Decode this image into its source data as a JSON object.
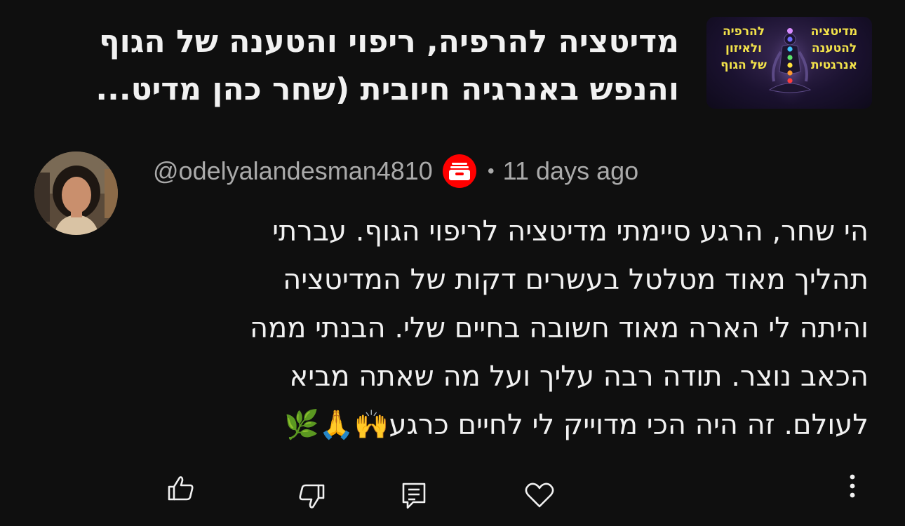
{
  "video": {
    "title_line1": "מדיטציה להרפיה, ריפוי והטענה של הגוף",
    "title_line2": "והנפש באנרגיה חיובית (שחר כהן מדיט...",
    "thumbnail": {
      "text_right": [
        "מדיטציה",
        "להטענה",
        "אנרגטית"
      ],
      "text_left": [
        "להרפיה",
        "ולאיזון",
        "של הגוף"
      ],
      "text_color": "#f3e34a"
    }
  },
  "comment": {
    "author": "@odelyalandesman4810",
    "separator": "•",
    "timestamp": "11 days ago",
    "badge_icon": "youtube-member-icon",
    "lines": [
      "הי שחר, הרגע סיימתי מדיטציה לריפוי הגוף. עברתי",
      "תהליך מאוד מטלטל בעשרים דקות של המדיטציה",
      "והיתה לי הארה מאוד חשובה בחיים שלי. הבנתי ממה",
      "הכאב נוצר. תודה רבה עליך ועל מה שאתה מביא",
      "לעולם. זה היה הכי מדוייק לי לחיים כרגע🙌🙏🌿"
    ]
  },
  "actions": {
    "like_icon": "thumbs-up-icon",
    "dislike_icon": "thumbs-down-icon",
    "reply_icon": "reply-icon",
    "heart_icon": "heart-icon",
    "more_icon": "more-vertical-icon"
  },
  "colors": {
    "background": "#0f0f0f",
    "text_primary": "#f1f1f1",
    "text_secondary": "#aaaaaa",
    "badge": "#ff0000"
  }
}
